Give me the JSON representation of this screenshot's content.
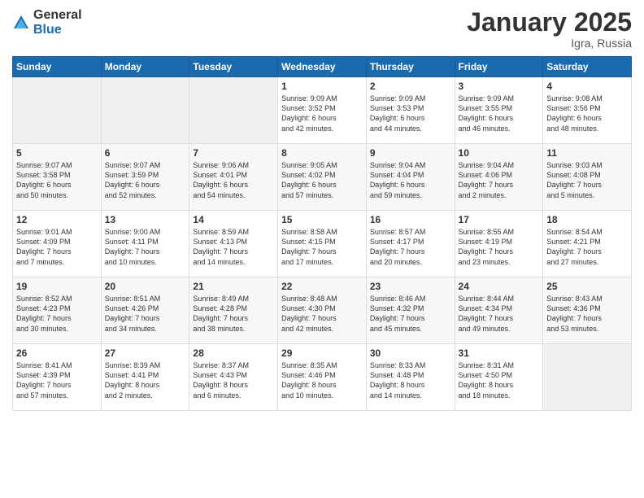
{
  "logo": {
    "general": "General",
    "blue": "Blue"
  },
  "title": "January 2025",
  "location": "Igra, Russia",
  "days_header": [
    "Sunday",
    "Monday",
    "Tuesday",
    "Wednesday",
    "Thursday",
    "Friday",
    "Saturday"
  ],
  "weeks": [
    [
      {
        "num": "",
        "info": ""
      },
      {
        "num": "",
        "info": ""
      },
      {
        "num": "",
        "info": ""
      },
      {
        "num": "1",
        "info": "Sunrise: 9:09 AM\nSunset: 3:52 PM\nDaylight: 6 hours\nand 42 minutes."
      },
      {
        "num": "2",
        "info": "Sunrise: 9:09 AM\nSunset: 3:53 PM\nDaylight: 6 hours\nand 44 minutes."
      },
      {
        "num": "3",
        "info": "Sunrise: 9:09 AM\nSunset: 3:55 PM\nDaylight: 6 hours\nand 46 minutes."
      },
      {
        "num": "4",
        "info": "Sunrise: 9:08 AM\nSunset: 3:56 PM\nDaylight: 6 hours\nand 48 minutes."
      }
    ],
    [
      {
        "num": "5",
        "info": "Sunrise: 9:07 AM\nSunset: 3:58 PM\nDaylight: 6 hours\nand 50 minutes."
      },
      {
        "num": "6",
        "info": "Sunrise: 9:07 AM\nSunset: 3:59 PM\nDaylight: 6 hours\nand 52 minutes."
      },
      {
        "num": "7",
        "info": "Sunrise: 9:06 AM\nSunset: 4:01 PM\nDaylight: 6 hours\nand 54 minutes."
      },
      {
        "num": "8",
        "info": "Sunrise: 9:05 AM\nSunset: 4:02 PM\nDaylight: 6 hours\nand 57 minutes."
      },
      {
        "num": "9",
        "info": "Sunrise: 9:04 AM\nSunset: 4:04 PM\nDaylight: 6 hours\nand 59 minutes."
      },
      {
        "num": "10",
        "info": "Sunrise: 9:04 AM\nSunset: 4:06 PM\nDaylight: 7 hours\nand 2 minutes."
      },
      {
        "num": "11",
        "info": "Sunrise: 9:03 AM\nSunset: 4:08 PM\nDaylight: 7 hours\nand 5 minutes."
      }
    ],
    [
      {
        "num": "12",
        "info": "Sunrise: 9:01 AM\nSunset: 4:09 PM\nDaylight: 7 hours\nand 7 minutes."
      },
      {
        "num": "13",
        "info": "Sunrise: 9:00 AM\nSunset: 4:11 PM\nDaylight: 7 hours\nand 10 minutes."
      },
      {
        "num": "14",
        "info": "Sunrise: 8:59 AM\nSunset: 4:13 PM\nDaylight: 7 hours\nand 14 minutes."
      },
      {
        "num": "15",
        "info": "Sunrise: 8:58 AM\nSunset: 4:15 PM\nDaylight: 7 hours\nand 17 minutes."
      },
      {
        "num": "16",
        "info": "Sunrise: 8:57 AM\nSunset: 4:17 PM\nDaylight: 7 hours\nand 20 minutes."
      },
      {
        "num": "17",
        "info": "Sunrise: 8:55 AM\nSunset: 4:19 PM\nDaylight: 7 hours\nand 23 minutes."
      },
      {
        "num": "18",
        "info": "Sunrise: 8:54 AM\nSunset: 4:21 PM\nDaylight: 7 hours\nand 27 minutes."
      }
    ],
    [
      {
        "num": "19",
        "info": "Sunrise: 8:52 AM\nSunset: 4:23 PM\nDaylight: 7 hours\nand 30 minutes."
      },
      {
        "num": "20",
        "info": "Sunrise: 8:51 AM\nSunset: 4:26 PM\nDaylight: 7 hours\nand 34 minutes."
      },
      {
        "num": "21",
        "info": "Sunrise: 8:49 AM\nSunset: 4:28 PM\nDaylight: 7 hours\nand 38 minutes."
      },
      {
        "num": "22",
        "info": "Sunrise: 8:48 AM\nSunset: 4:30 PM\nDaylight: 7 hours\nand 42 minutes."
      },
      {
        "num": "23",
        "info": "Sunrise: 8:46 AM\nSunset: 4:32 PM\nDaylight: 7 hours\nand 45 minutes."
      },
      {
        "num": "24",
        "info": "Sunrise: 8:44 AM\nSunset: 4:34 PM\nDaylight: 7 hours\nand 49 minutes."
      },
      {
        "num": "25",
        "info": "Sunrise: 8:43 AM\nSunset: 4:36 PM\nDaylight: 7 hours\nand 53 minutes."
      }
    ],
    [
      {
        "num": "26",
        "info": "Sunrise: 8:41 AM\nSunset: 4:39 PM\nDaylight: 7 hours\nand 57 minutes."
      },
      {
        "num": "27",
        "info": "Sunrise: 8:39 AM\nSunset: 4:41 PM\nDaylight: 8 hours\nand 2 minutes."
      },
      {
        "num": "28",
        "info": "Sunrise: 8:37 AM\nSunset: 4:43 PM\nDaylight: 8 hours\nand 6 minutes."
      },
      {
        "num": "29",
        "info": "Sunrise: 8:35 AM\nSunset: 4:46 PM\nDaylight: 8 hours\nand 10 minutes."
      },
      {
        "num": "30",
        "info": "Sunrise: 8:33 AM\nSunset: 4:48 PM\nDaylight: 8 hours\nand 14 minutes."
      },
      {
        "num": "31",
        "info": "Sunrise: 8:31 AM\nSunset: 4:50 PM\nDaylight: 8 hours\nand 18 minutes."
      },
      {
        "num": "",
        "info": ""
      }
    ]
  ]
}
